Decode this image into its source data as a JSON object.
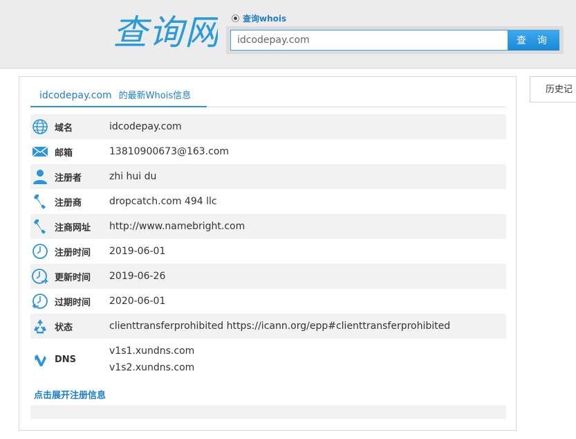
{
  "header": {
    "logo_text": "查询网",
    "radio_label": "查询whois",
    "search_value": "idcodepay.com",
    "search_button": "查 询"
  },
  "panel": {
    "domain": "idcodepay.com",
    "title_suffix": "的最新Whois信息",
    "rows": [
      {
        "icon": "globe-icon",
        "label": "域名",
        "value": "idcodepay.com"
      },
      {
        "icon": "mail-icon",
        "label": "邮箱",
        "value": "13810900673@163.com"
      },
      {
        "icon": "user-icon",
        "label": "注册者",
        "value": "zhi hui du"
      },
      {
        "icon": "wrench-icon",
        "label": "注册商",
        "value": "dropcatch.com 494 llc"
      },
      {
        "icon": "wrench-icon",
        "label": "注商网址",
        "value": "http://www.namebright.com"
      },
      {
        "icon": "clock-icon",
        "label": "注册时间",
        "value": "2019-06-01"
      },
      {
        "icon": "clock-refresh-icon",
        "label": "更新时间",
        "value": "2019-06-26"
      },
      {
        "icon": "clock-expire-icon",
        "label": "过期时间",
        "value": "2020-06-01"
      },
      {
        "icon": "recycle-icon",
        "label": "状态",
        "value": "clienttransferprohibited https://icann.org/epp#clienttransferprohibited"
      },
      {
        "icon": "dns-icon",
        "label": "DNS",
        "values": [
          "v1s1.xundns.com",
          "v1s2.xundns.com"
        ]
      }
    ],
    "expand_link": "点击展开注册信息"
  },
  "sidebar": {
    "history_tab": "历史记"
  },
  "colors": {
    "accent": "#1d7fbf",
    "button": "#2a95d8",
    "row_alt": "#f2f2f2"
  }
}
